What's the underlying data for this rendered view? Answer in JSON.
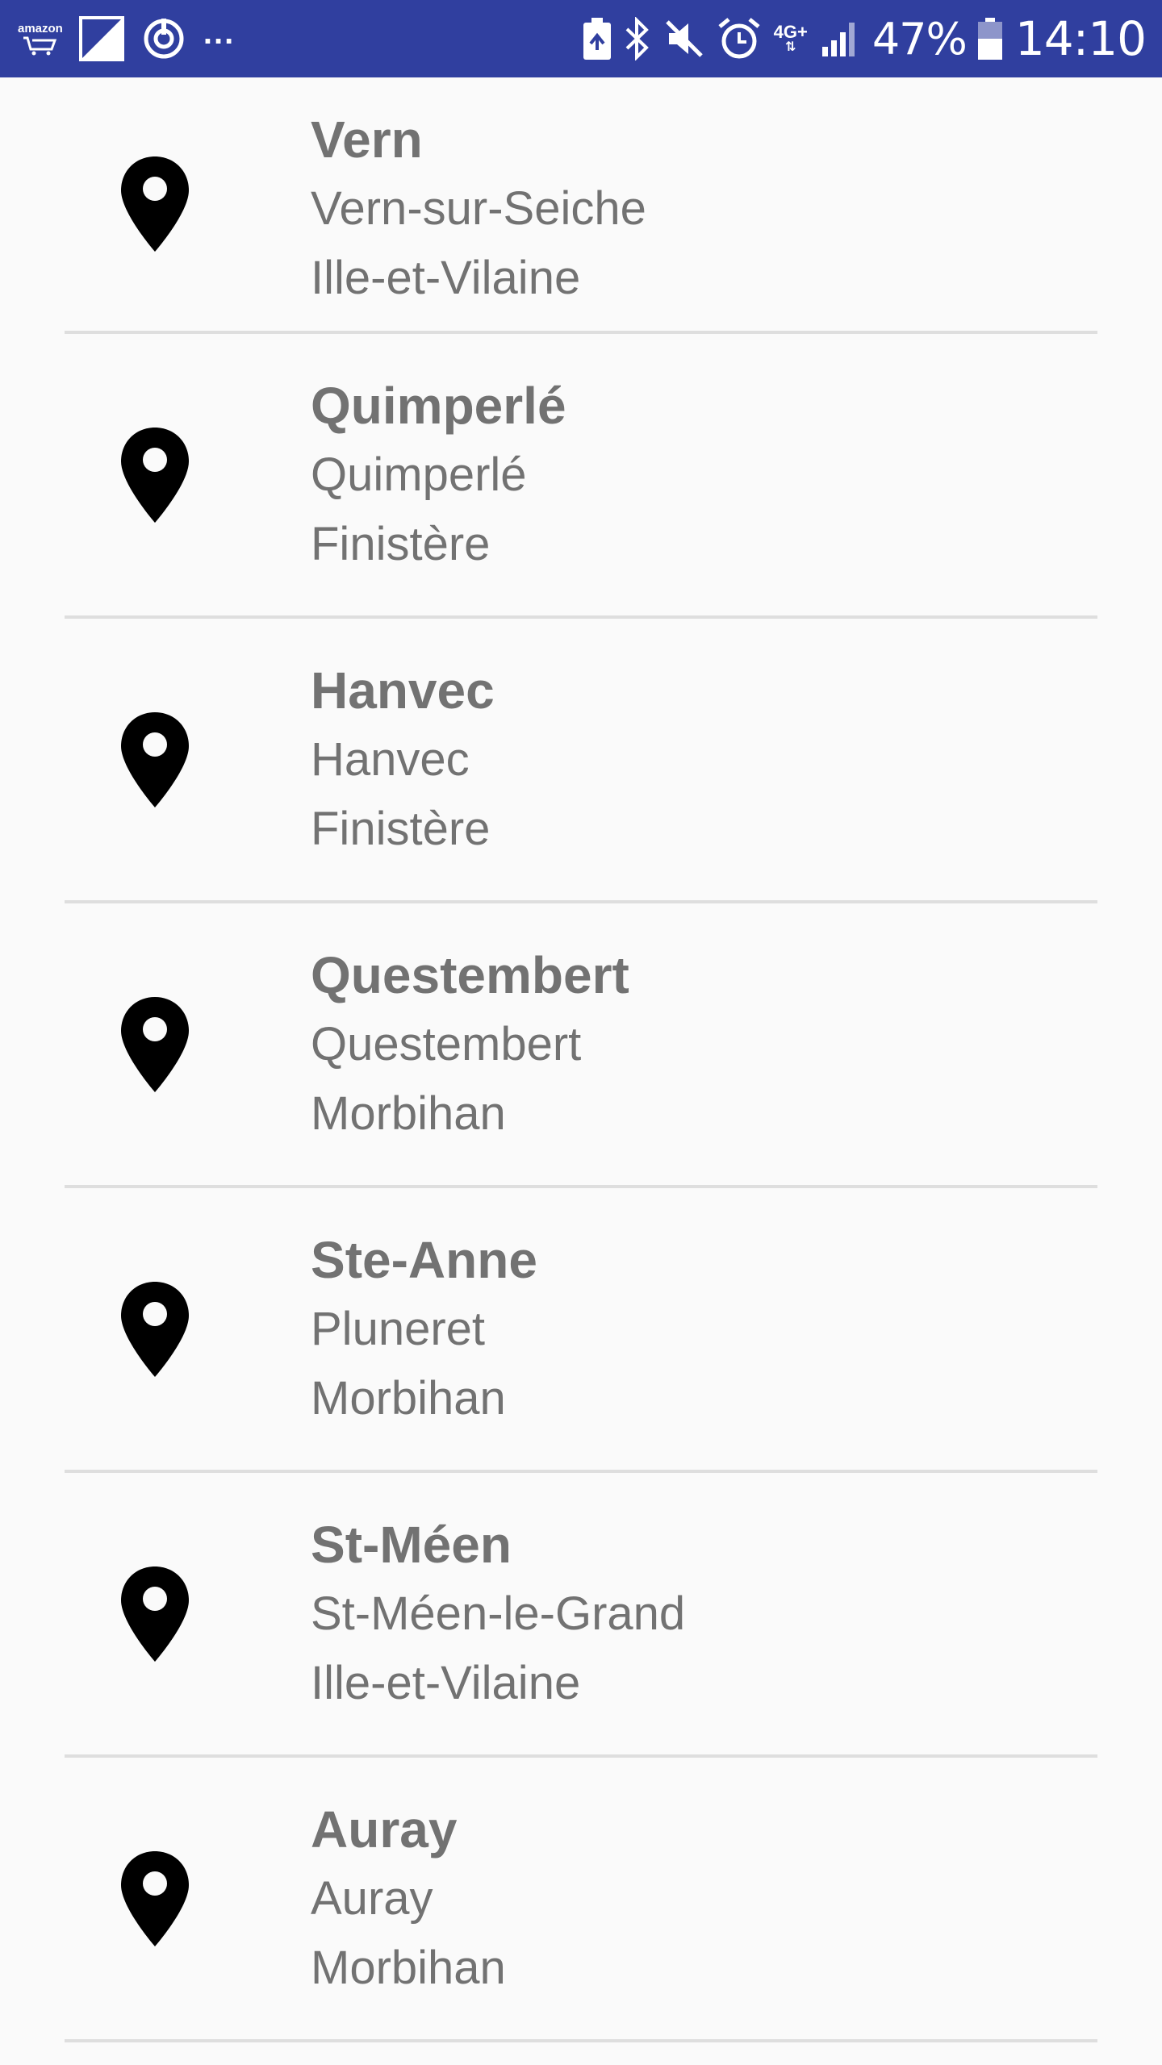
{
  "status_bar": {
    "amazon_label": "amazon",
    "overflow_dots": "...",
    "network_type": "4G+",
    "battery_percent": "47%",
    "time": "14:10",
    "left_icons": [
      "amazon-icon",
      "sim-signal-icon",
      "sync-icon"
    ],
    "right_icons": [
      "battery-saver-icon",
      "bluetooth-icon",
      "mute-icon",
      "alarm-icon",
      "signal-bars-icon",
      "battery-icon"
    ]
  },
  "locations": [
    {
      "name": "Vern",
      "city": "Vern-sur-Seiche",
      "department": "Ille-et-Vilaine"
    },
    {
      "name": "Quimperlé",
      "city": "Quimperlé",
      "department": "Finistère"
    },
    {
      "name": "Hanvec",
      "city": "Hanvec",
      "department": "Finistère"
    },
    {
      "name": "Questembert",
      "city": "Questembert",
      "department": "Morbihan"
    },
    {
      "name": "Ste-Anne",
      "city": "Pluneret",
      "department": "Morbihan"
    },
    {
      "name": "St-Méen",
      "city": "St-Méen-le-Grand",
      "department": "Ille-et-Vilaine"
    },
    {
      "name": "Auray",
      "city": "Auray",
      "department": "Morbihan"
    }
  ],
  "colors": {
    "status_bar": "#303f9f",
    "background": "#fafafa",
    "text": "#727272",
    "divider": "#dedede",
    "pin": "#000000"
  }
}
